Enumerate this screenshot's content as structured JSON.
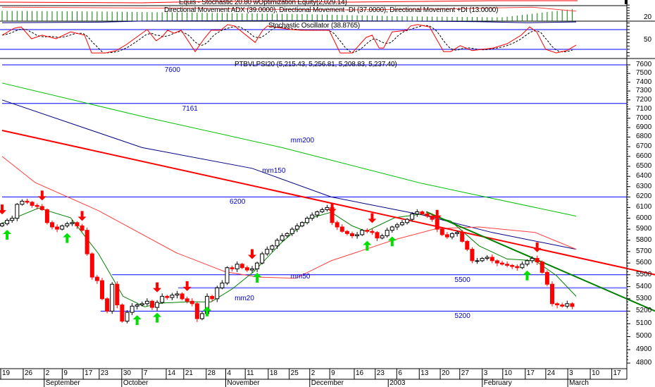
{
  "panels": {
    "equity_title": "Equis - Stochastic 20.80  wOptimization Equity(2,029.14)",
    "dmi_title": "Directional Movement ADX (39.0000), Directional Movement -DI (37.0000), Directional Movement +DI (13.0000)",
    "stoch_title": "Stochastic Oscillator (38.8765)",
    "price_title": "PTBVLPSI20 (5,215.43, 5,256.81, 5,208.83, 5,237.40)",
    "dmi_axis_label": "20",
    "stoch_axis_label": "50"
  },
  "colors": {
    "up": "#ffffff",
    "down": "#ff0000",
    "mm20": "#008000",
    "mm50": "#ff4040",
    "mm150": "#000080",
    "mm200": "#00c000",
    "trend_red": "#ff0000",
    "trend_green": "#008000",
    "level": "#0000ff",
    "buy": "#00e000",
    "sell": "#ff0000"
  },
  "chart_data": {
    "type": "candlestick",
    "title": "PTBVLPSI20",
    "ylim": [
      4800,
      7600
    ],
    "yscale": "log",
    "yticks": [
      7600,
      7500,
      7400,
      7300,
      7200,
      7100,
      7000,
      6900,
      6800,
      6700,
      6600,
      6500,
      6400,
      6300,
      6200,
      6100,
      6000,
      5900,
      5800,
      5700,
      5600,
      5500,
      5400,
      5300,
      5200,
      5100,
      5000,
      4900,
      4800
    ],
    "closes": [
      5950,
      5980,
      6000,
      6130,
      6160,
      6150,
      6120,
      6110,
      6080,
      5960,
      5920,
      5900,
      5930,
      5950,
      5960,
      5930,
      5890,
      5680,
      5480,
      5450,
      5300,
      5200,
      5420,
      5250,
      5120,
      5190,
      5240,
      5250,
      5260,
      5280,
      5230,
      5270,
      5320,
      5310,
      5330,
      5340,
      5300,
      5280,
      5260,
      5140,
      5180,
      5320,
      5300,
      5390,
      5430,
      5560,
      5550,
      5590,
      5560,
      5540,
      5550,
      5600,
      5680,
      5720,
      5750,
      5800,
      5840,
      5860,
      5900,
      5930,
      5960,
      6000,
      6030,
      6060,
      6080,
      6100,
      5960,
      5920,
      5880,
      5860,
      5840,
      5850,
      5890,
      5880,
      5870,
      5820,
      5840,
      5890,
      5920,
      5940,
      5960,
      5990,
      6040,
      6060,
      6040,
      6020,
      5990,
      5900,
      5850,
      5830,
      5860,
      5870,
      5790,
      5720,
      5620,
      5620,
      5640,
      5650,
      5620,
      5600,
      5590,
      5580,
      5570,
      5560,
      5590,
      5620,
      5640,
      5610,
      5520,
      5420,
      5260,
      5250,
      5240,
      5260,
      5237.4
    ],
    "x_ticks": [
      {
        "label": "19",
        "bar": 0
      },
      {
        "label": "26",
        "bar": 4.5
      },
      {
        "label": "2",
        "bar": 8.7
      },
      {
        "label": "9",
        "bar": 12.3
      },
      {
        "label": "17",
        "bar": 16.5
      },
      {
        "label": "23",
        "bar": 19.7
      },
      {
        "label": "30",
        "bar": 24.2
      },
      {
        "label": "7",
        "bar": 28.3
      },
      {
        "label": "14",
        "bar": 33.1
      },
      {
        "label": "21",
        "bar": 36.6
      },
      {
        "label": "28",
        "bar": 41.1
      },
      {
        "label": "4",
        "bar": 45
      },
      {
        "label": "11",
        "bar": 48.9
      },
      {
        "label": "18",
        "bar": 53.5
      },
      {
        "label": "25",
        "bar": 57.7
      },
      {
        "label": "2",
        "bar": 61.8
      },
      {
        "label": "9",
        "bar": 65.8
      },
      {
        "label": "16",
        "bar": 70.7
      },
      {
        "label": "23",
        "bar": 74.9
      },
      {
        "label": "6",
        "bar": 79.2
      },
      {
        "label": "13",
        "bar": 83.7
      },
      {
        "label": "20",
        "bar": 87.9
      },
      {
        "label": "27",
        "bar": 91.8
      },
      {
        "label": "3",
        "bar": 96.3
      },
      {
        "label": "10",
        "bar": 100.4
      },
      {
        "label": "17",
        "bar": 104.9
      },
      {
        "label": "24",
        "bar": 109
      },
      {
        "label": "3",
        "bar": 113.4
      },
      {
        "label": "10",
        "bar": 117.9
      },
      {
        "label": "17",
        "bar": 122.2
      }
    ],
    "months": [
      {
        "label": "September",
        "bar": 8.7
      },
      {
        "label": "October",
        "bar": 24.2
      },
      {
        "label": "November",
        "bar": 45
      },
      {
        "label": "December",
        "bar": 61.8
      },
      {
        "label": "2003",
        "bar": 77.5
      },
      {
        "label": "February",
        "bar": 96.3
      },
      {
        "label": "March",
        "bar": 113.4
      }
    ],
    "levels": [
      {
        "value": 7600,
        "label": "7600",
        "from_bar": 0,
        "label_bar": 32.5
      },
      {
        "value": 7161,
        "label": "7161",
        "from_bar": 0,
        "label_bar": 36
      },
      {
        "value": 6200,
        "label": "6200",
        "from_bar": 0,
        "label_bar": 45.5
      },
      {
        "value": 5500,
        "label": "5500",
        "from_bar": 22,
        "label_bar": 90.5
      },
      {
        "value": 5390,
        "label": "",
        "from_bar": 35.2,
        "label_bar": null
      },
      {
        "value": 5200,
        "label": "5200",
        "from_bar": 19.7,
        "label_bar": 90.5
      }
    ],
    "series": [
      {
        "name": "mm200",
        "label": "mm200",
        "label_at": [
          57.7,
          6760
        ],
        "points": [
          [
            0,
            7390
          ],
          [
            28,
            7020
          ],
          [
            56,
            6690
          ],
          [
            84,
            6330
          ],
          [
            114.8,
            6020
          ]
        ]
      },
      {
        "name": "mm150",
        "label": "mm150",
        "label_at": [
          52,
          6450
        ],
        "points": [
          [
            0,
            7200
          ],
          [
            28,
            6690
          ],
          [
            50,
            6480
          ],
          [
            65.8,
            6200
          ],
          [
            84.1,
            6030
          ],
          [
            98,
            5870
          ],
          [
            114.8,
            5720
          ]
        ]
      },
      {
        "name": "mm50",
        "label": "mm50",
        "label_at": [
          57.7,
          5480
        ],
        "points": [
          [
            0,
            6600
          ],
          [
            6.6,
            6340
          ],
          [
            19.3,
            6070
          ],
          [
            34.8,
            5690
          ],
          [
            44.6,
            5525
          ],
          [
            51.3,
            5480
          ],
          [
            58.7,
            5470
          ],
          [
            65.8,
            5620
          ],
          [
            78.5,
            5805
          ],
          [
            86.9,
            5905
          ],
          [
            95.4,
            5920
          ],
          [
            106.6,
            5870
          ],
          [
            114.8,
            5720
          ]
        ]
      },
      {
        "name": "mm20",
        "label": "mm20",
        "label_at": [
          46.5,
          5300
        ],
        "points": [
          [
            0,
            5955
          ],
          [
            7.3,
            6095
          ],
          [
            13.7,
            6005
          ],
          [
            19.3,
            5680
          ],
          [
            24.2,
            5320
          ],
          [
            28.5,
            5235
          ],
          [
            32,
            5265
          ],
          [
            36.9,
            5275
          ],
          [
            41.8,
            5275
          ],
          [
            46,
            5380
          ],
          [
            50.3,
            5525
          ],
          [
            55.9,
            5780
          ],
          [
            61.5,
            6000
          ],
          [
            65.8,
            6055
          ],
          [
            70,
            5930
          ],
          [
            72.8,
            5880
          ],
          [
            78.5,
            6005
          ],
          [
            84.1,
            6040
          ],
          [
            89.7,
            5975
          ],
          [
            95.4,
            5750
          ],
          [
            101,
            5635
          ],
          [
            106.6,
            5620
          ],
          [
            110.8,
            5495
          ],
          [
            114.8,
            5320
          ]
        ]
      },
      {
        "name": "trend_red",
        "label": "",
        "points": [
          [
            0,
            6870
          ],
          [
            130.6,
            5500
          ]
        ]
      },
      {
        "name": "trend_green",
        "label": "",
        "points": [
          [
            84.8,
            6060
          ],
          [
            130.6,
            5200
          ]
        ]
      }
    ],
    "signals": [
      {
        "bar": 0,
        "type": "sell"
      },
      {
        "bar": 8,
        "type": "sell"
      },
      {
        "bar": 16,
        "type": "sell"
      },
      {
        "bar": 31,
        "type": "sell"
      },
      {
        "bar": 37,
        "type": "sell"
      },
      {
        "bar": 50,
        "type": "sell"
      },
      {
        "bar": 66,
        "type": "sell"
      },
      {
        "bar": 74,
        "type": "sell"
      },
      {
        "bar": 87,
        "type": "sell"
      },
      {
        "bar": 107,
        "type": "sell"
      },
      {
        "bar": 1,
        "type": "buy"
      },
      {
        "bar": 13,
        "type": "buy"
      },
      {
        "bar": 27,
        "type": "buy"
      },
      {
        "bar": 31,
        "type": "buy"
      },
      {
        "bar": 41,
        "type": "buy"
      },
      {
        "bar": 51,
        "type": "buy"
      },
      {
        "bar": 73,
        "type": "buy"
      },
      {
        "bar": 78,
        "type": "buy"
      },
      {
        "bar": 105,
        "type": "buy"
      }
    ],
    "stochastic": {
      "upper": 80,
      "lower": 20,
      "k": [
        [
          0,
          63
        ],
        [
          2.4,
          84
        ],
        [
          3.8,
          88
        ],
        [
          5.9,
          52
        ],
        [
          8,
          63
        ],
        [
          10.8,
          52
        ],
        [
          13.7,
          73
        ],
        [
          16.5,
          63
        ],
        [
          17.9,
          9
        ],
        [
          20.7,
          9
        ],
        [
          22.8,
          16
        ],
        [
          24.9,
          35
        ],
        [
          29,
          80
        ],
        [
          30.8,
          46
        ],
        [
          32,
          58
        ],
        [
          33.1,
          78
        ],
        [
          34.4,
          69
        ],
        [
          35.8,
          78
        ],
        [
          38.6,
          13
        ],
        [
          40.4,
          52
        ],
        [
          41.8,
          78
        ],
        [
          43.7,
          78
        ],
        [
          45.1,
          95
        ],
        [
          46.5,
          91
        ],
        [
          50.6,
          41
        ],
        [
          52.1,
          78
        ],
        [
          53.1,
          91
        ],
        [
          57.7,
          80
        ],
        [
          59.7,
          78
        ],
        [
          65.4,
          78
        ],
        [
          67.6,
          9
        ],
        [
          70,
          9
        ],
        [
          72.8,
          56
        ],
        [
          74,
          63
        ],
        [
          75.4,
          24
        ],
        [
          76.3,
          24
        ],
        [
          78,
          73
        ],
        [
          80.9,
          78
        ],
        [
          81.7,
          91
        ],
        [
          83.1,
          95
        ],
        [
          85.5,
          88
        ],
        [
          88.3,
          13
        ],
        [
          89.7,
          13
        ],
        [
          91.6,
          31
        ],
        [
          94,
          16
        ],
        [
          98.2,
          24
        ],
        [
          101,
          37
        ],
        [
          103.8,
          63
        ],
        [
          105.5,
          88
        ],
        [
          106.9,
          73
        ],
        [
          108.7,
          20
        ],
        [
          110.8,
          9
        ],
        [
          112.9,
          16
        ],
        [
          114.8,
          33
        ]
      ]
    },
    "dmi": {
      "adx": [
        [
          0,
          32
        ],
        [
          20,
          30
        ],
        [
          40,
          26
        ],
        [
          60,
          22
        ],
        [
          80,
          15
        ],
        [
          100,
          12
        ],
        [
          114.8,
          39
        ]
      ],
      "minus_di": [
        [
          0,
          52
        ],
        [
          20,
          50
        ],
        [
          40,
          48
        ],
        [
          55,
          44
        ],
        [
          70,
          42
        ],
        [
          90,
          46
        ],
        [
          100,
          50
        ],
        [
          106,
          52
        ],
        [
          114.8,
          37
        ]
      ],
      "plus_di": [
        [
          0,
          10
        ],
        [
          20,
          12
        ],
        [
          28,
          16
        ],
        [
          40,
          17
        ],
        [
          60,
          18
        ],
        [
          80,
          16
        ],
        [
          95,
          14
        ],
        [
          105,
          10
        ],
        [
          114.8,
          13
        ]
      ]
    }
  }
}
